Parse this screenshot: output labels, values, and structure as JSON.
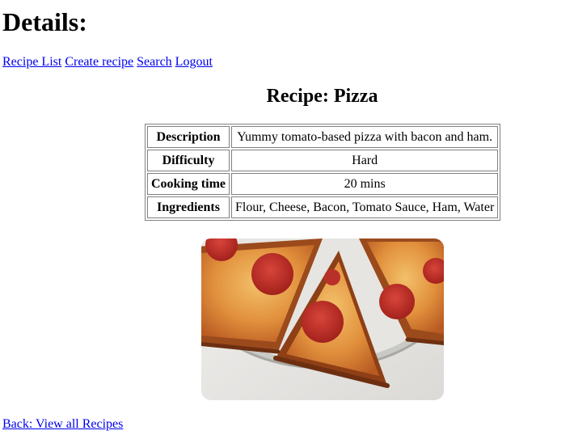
{
  "page": {
    "heading": "Details:"
  },
  "nav": {
    "recipe_list": "Recipe List",
    "create_recipe": "Create recipe",
    "search": "Search",
    "logout": "Logout"
  },
  "recipe": {
    "title": "Recipe: Pizza",
    "rows": [
      {
        "label": "Description",
        "value": "Yummy tomato-based pizza with bacon and ham."
      },
      {
        "label": "Difficulty",
        "value": "Hard"
      },
      {
        "label": "Cooking time",
        "value": "20 mins"
      },
      {
        "label": "Ingredients",
        "value": "Flour, Cheese, Bacon, Tomato Sauce, Ham, Water"
      }
    ]
  },
  "footer": {
    "back_link": "Back: View all Recipes"
  },
  "colors": {
    "link": "#0000ee",
    "table_border": "#808080"
  }
}
